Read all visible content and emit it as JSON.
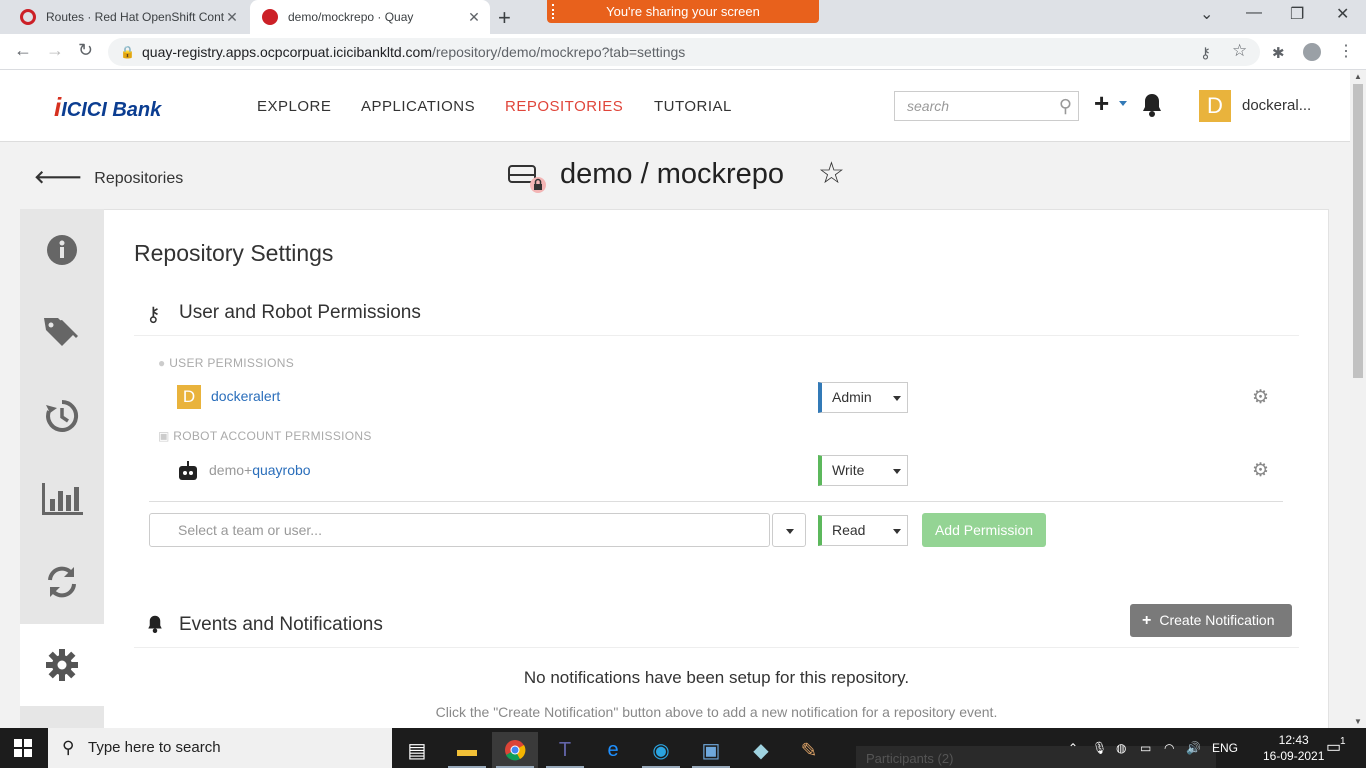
{
  "browser": {
    "tabs": [
      {
        "title": "Routes · Red Hat OpenShift Cont",
        "active": false
      },
      {
        "title": "demo/mockrepo · Quay",
        "active": true
      }
    ],
    "share_banner": "You're sharing your screen",
    "url_host": "quay-registry.apps.ocpcorpuat.icicibankltd.com",
    "url_path": "/repository/demo/mockrepo?tab=settings"
  },
  "header": {
    "logo": "ICICI Bank",
    "nav": [
      "EXPLORE",
      "APPLICATIONS",
      "REPOSITORIES",
      "TUTORIAL"
    ],
    "active_nav": "REPOSITORIES",
    "search_placeholder": "search",
    "avatar_letter": "D",
    "username": "dockeral..."
  },
  "repo": {
    "back_label": "Repositories",
    "title": "demo / mockrepo"
  },
  "sidebar": {
    "tabs": [
      "info-icon",
      "tags-icon",
      "history-icon",
      "usage-chart-icon",
      "builds-icon",
      "settings-icon"
    ],
    "active": "settings-icon"
  },
  "settings": {
    "page_title": "Repository Settings",
    "permissions_title": "User and Robot Permissions",
    "user_perms_label": "USER PERMISSIONS",
    "robot_perms_label": "ROBOT ACCOUNT PERMISSIONS",
    "user": {
      "avatar": "D",
      "name": "dockeralert",
      "role": "Admin"
    },
    "robot": {
      "prefix": "demo+",
      "name": "quayrobo",
      "role": "Write"
    },
    "add": {
      "placeholder": "Select a team or user...",
      "role": "Read",
      "button": "Add Permission"
    },
    "events_title": "Events and Notifications",
    "create_button": "Create Notification",
    "empty_title": "No notifications have been setup for this repository.",
    "empty_desc": "Click the \"Create Notification\" button above to add a new notification for a repository event."
  },
  "taskbar": {
    "search_placeholder": "Type here to search",
    "language": "ENG",
    "time": "12:43",
    "date": "16-09-2021",
    "participants": "Participants (2)",
    "notification_count": "1"
  },
  "colors": {
    "accent_nav": "#e0453a",
    "link": "#2a6ebb",
    "admin": "#337ab7",
    "write": "#5cb85c",
    "share_banner": "#e8611c"
  }
}
